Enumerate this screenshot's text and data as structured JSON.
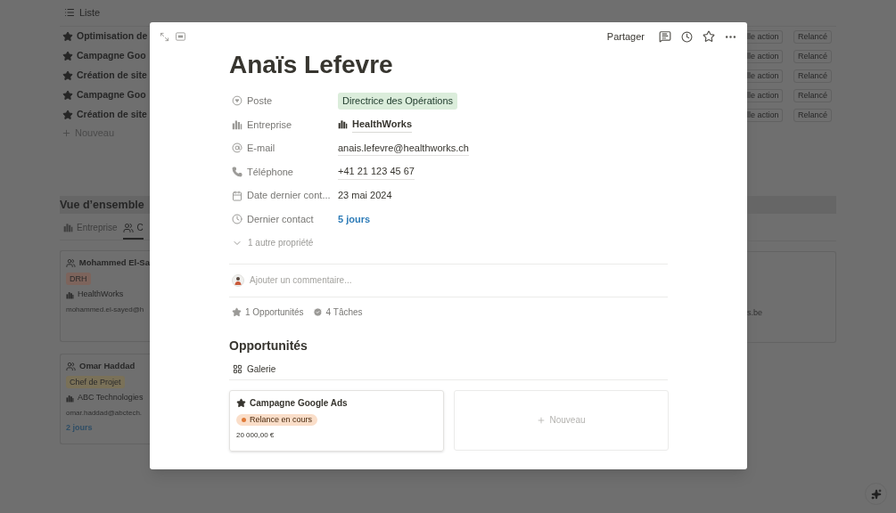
{
  "background": {
    "list_view": {
      "label": "Liste",
      "items": [
        {
          "title": "Optimisation de",
          "next_action": "lle action",
          "status": "Relancé"
        },
        {
          "title": "Campagne Goo",
          "next_action": "lle action",
          "status": "Relancé"
        },
        {
          "title": "Création de site",
          "next_action": "lle action",
          "status": "Relancé"
        },
        {
          "title": "Campagne Goo",
          "next_action": "lle action",
          "status": "Relancé"
        },
        {
          "title": "Création de site",
          "next_action": "lle action",
          "status": "Relancé"
        }
      ],
      "new_label": "Nouveau"
    },
    "overview": {
      "title": "Vue d’ensemble",
      "tabs": [
        {
          "label": "Entreprise",
          "kind": "company",
          "selected": false
        },
        {
          "label": "C",
          "kind": "people",
          "selected": true
        }
      ],
      "cards": [
        {
          "name": "Mohammed El-Sa",
          "tag": "DRH",
          "color": "#7d645c",
          "company": "HealthWorks",
          "email": "mohammed.el-sayed@h"
        },
        {
          "name": "Omar Haddad",
          "tag": "Chef de Projet",
          "color": "#7a7158",
          "company": "ABC Technologies",
          "email": "omar.haddad@abctech.",
          "last_contact": "2 jours"
        }
      ],
      "right_cards": [
        {
          "email": "s.be"
        }
      ]
    }
  },
  "modal": {
    "share": "Partager",
    "title": "Anaïs Lefevre",
    "properties": [
      {
        "kind": "select",
        "label": "Poste",
        "value": "Directrice des Opérations"
      },
      {
        "kind": "relation",
        "label": "Entreprise",
        "value": "HealthWorks"
      },
      {
        "kind": "email",
        "label": "E-mail",
        "value": "anais.lefevre@healthworks.ch"
      },
      {
        "kind": "phone",
        "label": "Téléphone",
        "value": "+41 21 123 45 67"
      },
      {
        "kind": "date",
        "label": "Date dernier cont...",
        "value": "23 mai 2024"
      },
      {
        "kind": "formula",
        "label": "Dernier contact",
        "value": "5 jours"
      }
    ],
    "more_properties": "1 autre propriété",
    "comment": {
      "placeholder": "Ajouter un commentaire..."
    },
    "backlinks": [
      {
        "kind": "opportunities",
        "label": "1 Opportunités"
      },
      {
        "kind": "tasks",
        "label": "4 Tâches"
      }
    ],
    "section_title": "Opportunités",
    "view_tab": "Galerie",
    "gallery": [
      {
        "title": "Campagne Google Ads",
        "status": "Relance en cours",
        "color": "#e07b39",
        "amount": "20 000,00 €"
      }
    ],
    "new_card": "Nouveau"
  }
}
